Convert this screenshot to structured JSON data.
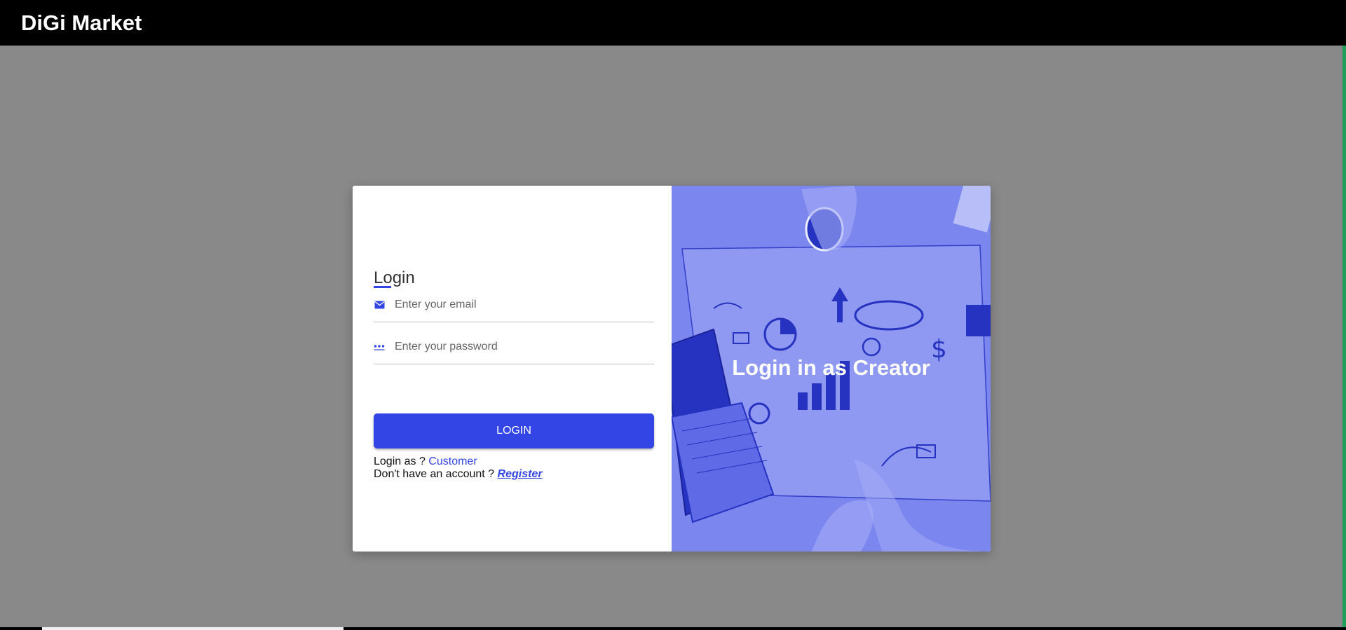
{
  "app": {
    "brand": "DiGi Market"
  },
  "colors": {
    "accent": "#3445e5",
    "overlay": "#7b86ee",
    "navbar": "#000000",
    "backdrop": "#898989"
  },
  "form": {
    "title": "Login",
    "email_placeholder": "Enter your email",
    "email_icon": "mail-icon",
    "password_placeholder": "Enter your password",
    "password_icon": "password-dots-icon",
    "login_label": "LOGIN",
    "login_as_prefix": "Login as ?",
    "customer_link": "Customer",
    "no_account_prefix": "Don't have an account ?",
    "register_link": "Register"
  },
  "hero": {
    "text": "Login in as Creator"
  }
}
